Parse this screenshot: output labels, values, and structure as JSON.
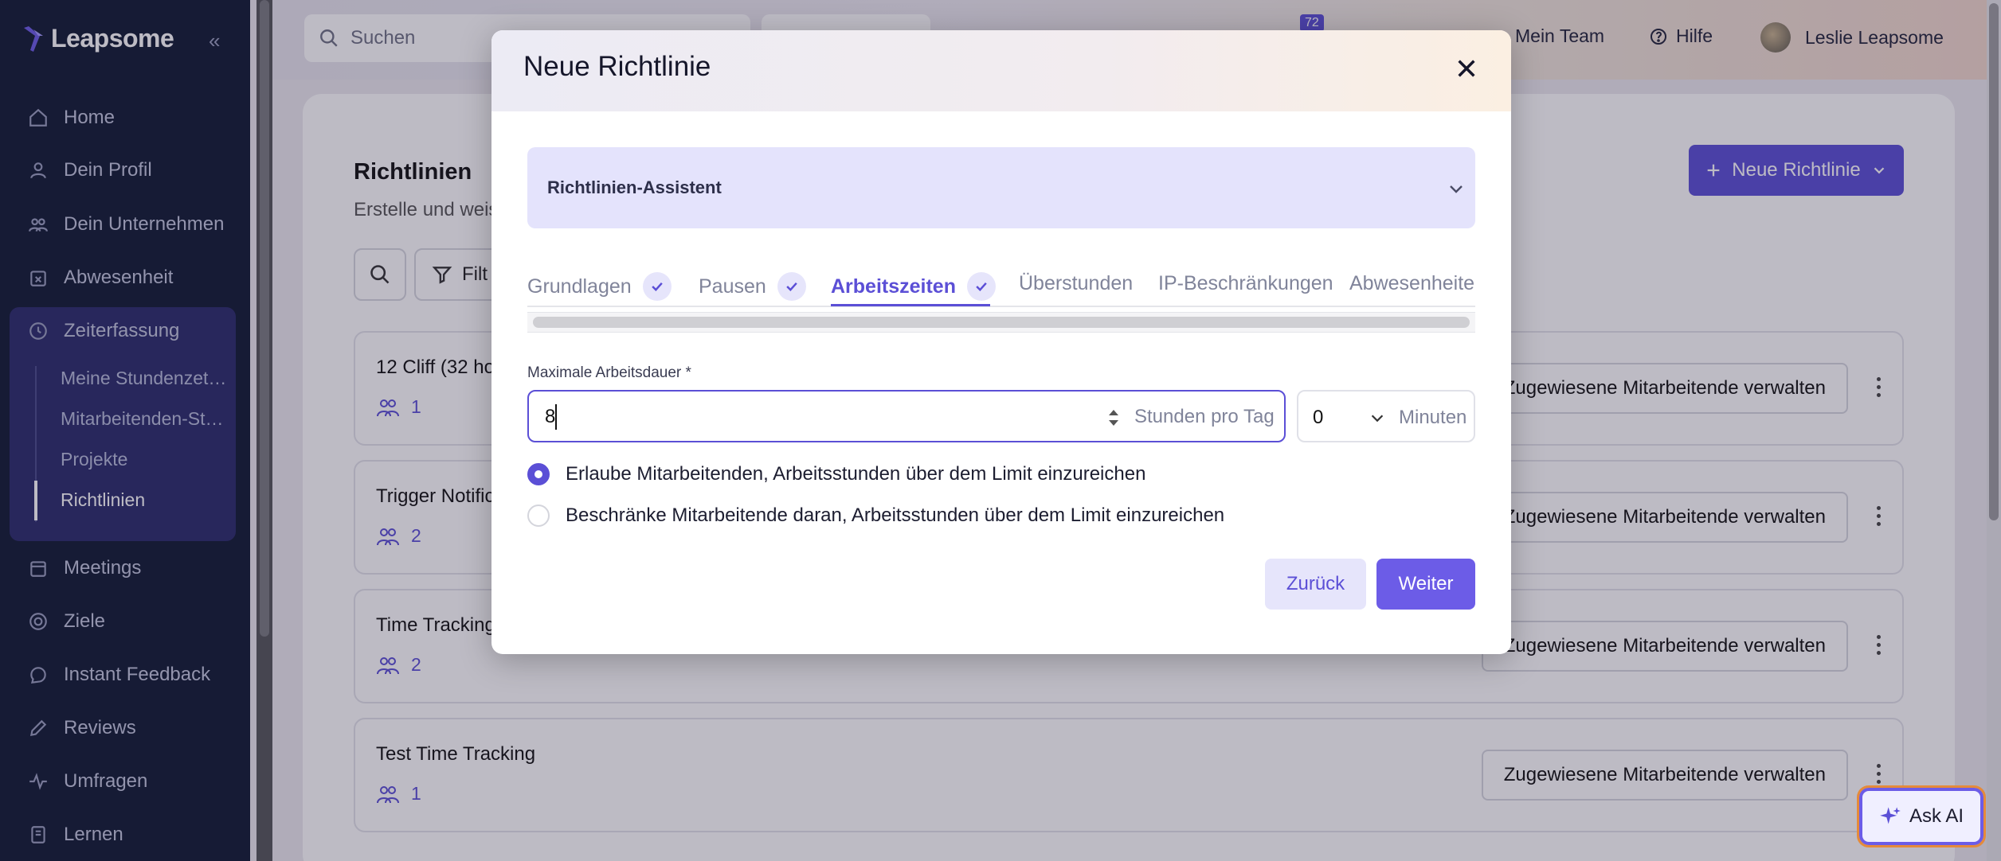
{
  "brand": {
    "name": "Leapsome"
  },
  "sidebar": {
    "items": [
      {
        "label": "Home",
        "icon": "home-icon"
      },
      {
        "label": "Dein Profil",
        "icon": "user-icon"
      },
      {
        "label": "Dein Unternehmen",
        "icon": "users-icon"
      },
      {
        "label": "Abwesenheit",
        "icon": "calendar-x-icon"
      },
      {
        "label": "Zeiterfassung",
        "icon": "clock-icon"
      },
      {
        "label": "Meetings",
        "icon": "calendar-icon"
      },
      {
        "label": "Ziele",
        "icon": "target-icon"
      },
      {
        "label": "Instant Feedback",
        "icon": "chat-icon"
      },
      {
        "label": "Reviews",
        "icon": "pencil-icon"
      },
      {
        "label": "Umfragen",
        "icon": "pulse-icon"
      },
      {
        "label": "Lernen",
        "icon": "book-icon"
      }
    ],
    "subitems": [
      "Meine Stundenzet…",
      "Mitarbeitenden-St…",
      "Projekte",
      "Richtlinien"
    ]
  },
  "topbar": {
    "search_placeholder": "Suchen",
    "badge": "72",
    "my_team": "Mein Team",
    "help": "Hilfe",
    "user": "Leslie Leapsome"
  },
  "page": {
    "title": "Richtlinien",
    "subtitle": "Erstelle und weis",
    "filter_label": "Filt",
    "new_button": "Neue Richtlinie",
    "manage_label": "Zugewiesene Mitarbeitende verwalten",
    "rows": [
      {
        "name": "12 Cliff (32 ho",
        "count": "1"
      },
      {
        "name": "Trigger Notific",
        "count": "2"
      },
      {
        "name": "Time Tracking",
        "count": "2"
      },
      {
        "name": "Test Time Tracking",
        "count": "1"
      }
    ]
  },
  "ask_ai": "Ask AI",
  "modal": {
    "title": "Neue Richtlinie",
    "assistant_label": "Richtlinien-Assistent",
    "tabs": [
      {
        "label": "Grundlagen",
        "done": true
      },
      {
        "label": "Pausen",
        "done": true
      },
      {
        "label": "Arbeitszeiten",
        "done": true
      },
      {
        "label": "Überstunden",
        "done": false
      },
      {
        "label": "IP-Beschränkungen",
        "done": false
      },
      {
        "label": "Abwesenheite",
        "done": false
      }
    ],
    "field_label": "Maximale Arbeitsdauer *",
    "hours_value": "8",
    "hours_suffix": "Stunden pro Tag",
    "minutes_value": "0",
    "minutes_suffix": "Minuten",
    "radio_allow": "Erlaube Mitarbeitenden, Arbeitsstunden über dem Limit einzureichen",
    "radio_restrict": "Beschränke Mitarbeitende daran, Arbeitsstunden über dem Limit einzureichen",
    "back": "Zurück",
    "next": "Weiter"
  },
  "colors": {
    "accent": "#5b4fd6",
    "sidebar": "#111a33"
  }
}
